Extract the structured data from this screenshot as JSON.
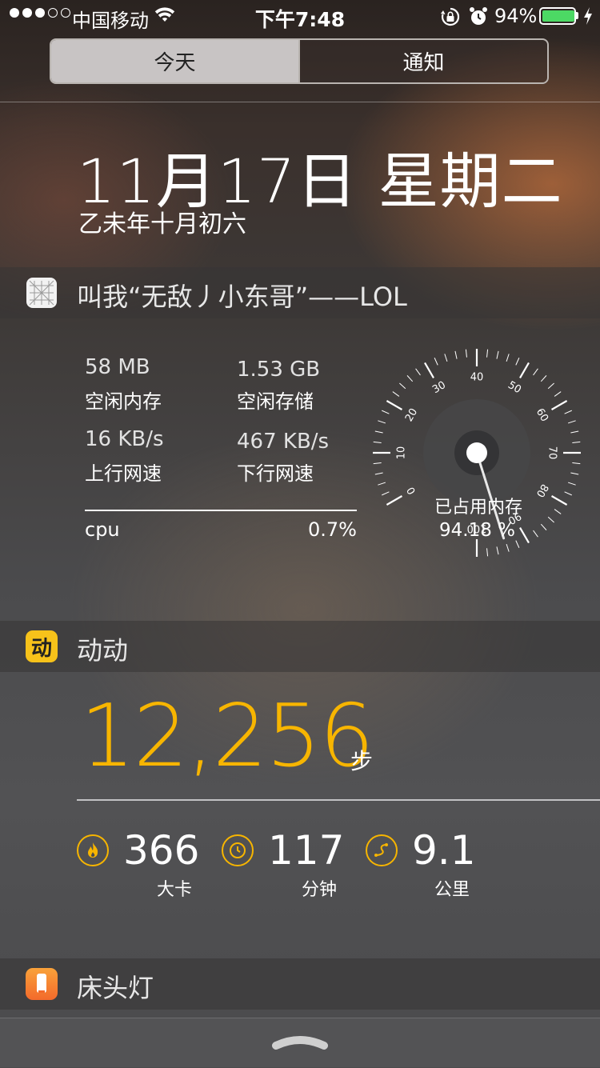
{
  "status_bar": {
    "carrier": "中国移动",
    "time": "下午7:48",
    "battery_percent": "94%",
    "battery_level": 0.94,
    "signal_bars_on": 3,
    "icons": [
      "wifi-icon",
      "rotation-lock-icon",
      "alarm-icon",
      "battery-icon",
      "charging-icon"
    ]
  },
  "tabs": {
    "today": "今天",
    "notifications": "通知"
  },
  "header": {
    "date": "11月17日 星期二",
    "lunar": "乙未年十月初六"
  },
  "system_widget": {
    "title": "叫我“无敌丿小东哥”——LOL",
    "free_memory": {
      "value": "58 MB",
      "label": "空闲内存"
    },
    "free_storage": {
      "value": "1.53 GB",
      "label": "空闲存储"
    },
    "upload": {
      "value": "16 KB/s",
      "label": "上行网速"
    },
    "download": {
      "value": "467 KB/s",
      "label": "下行网速"
    },
    "cpu": {
      "label": "cpu",
      "value": "0.7%"
    },
    "gauge": {
      "label": "已占用内存",
      "value_text": "94.18 %",
      "value": 94.18,
      "ticks": [
        "0",
        "10",
        "20",
        "30",
        "40",
        "50",
        "60",
        "70",
        "80",
        "90",
        "100"
      ]
    }
  },
  "dongdong_widget": {
    "title": "动动",
    "icon_char": "动",
    "steps": "12,256",
    "steps_unit": "步",
    "calories": {
      "value": "366",
      "label": "大卡"
    },
    "minutes": {
      "value": "117",
      "label": "分钟"
    },
    "distance": {
      "value": "9.1",
      "label": "公里"
    },
    "accent": "#f7b500"
  },
  "lamp_widget": {
    "title": "床头灯"
  }
}
